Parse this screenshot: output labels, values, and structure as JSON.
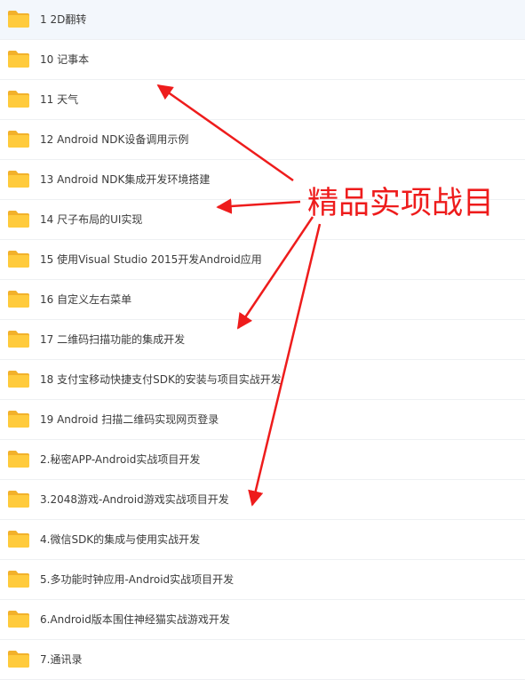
{
  "folders": [
    {
      "name": "1 2D翻转",
      "selected": true
    },
    {
      "name": "10 记事本"
    },
    {
      "name": "11 天气"
    },
    {
      "name": "12 Android NDK设备调用示例"
    },
    {
      "name": "13 Android NDK集成开发环境搭建"
    },
    {
      "name": "14 尺子布局的UI实现"
    },
    {
      "name": "15 使用Visual Studio 2015开发Android应用"
    },
    {
      "name": "16 自定义左右菜单"
    },
    {
      "name": "17 二维码扫描功能的集成开发"
    },
    {
      "name": "18 支付宝移动快捷支付SDK的安装与项目实战开发"
    },
    {
      "name": "19 Android 扫描二维码实现网页登录"
    },
    {
      "name": "2.秘密APP-Android实战项目开发"
    },
    {
      "name": "3.2048游戏-Android游戏实战项目开发"
    },
    {
      "name": "4.微信SDK的集成与使用实战开发"
    },
    {
      "name": "5.多功能时钟应用-Android实战项目开发"
    },
    {
      "name": "6.Android版本围住神经猫实战游戏开发"
    },
    {
      "name": "7.通讯录"
    }
  ],
  "annotation": {
    "label": "精品实项战目",
    "color": "#ee1c1c",
    "arrow_targets": [
      "10 记事本",
      "14 尺子布局的UI实现",
      "17 二维码扫描功能的集成开发",
      "3.2048游戏-Android游戏实战项目开发"
    ]
  },
  "folder_icon": {
    "name": "folder-icon",
    "color": "#ffc936"
  }
}
